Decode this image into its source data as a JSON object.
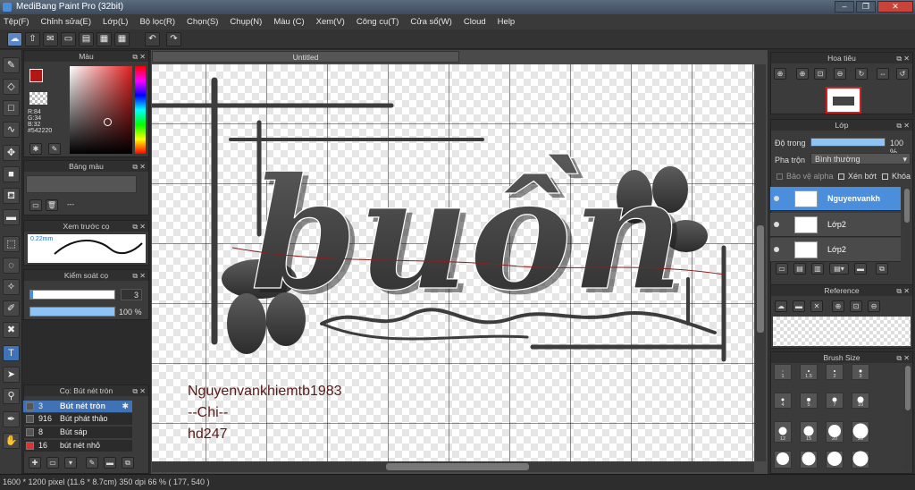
{
  "window": {
    "title": "MediBang Paint Pro (32bit)"
  },
  "menu": [
    "Tệp(F)",
    "Chỉnh sửa(E)",
    "Lớp(L)",
    "Bộ lọc(R)",
    "Chọn(S)",
    "Chụp(N)",
    "Màu (C)",
    "Xem(V)",
    "Công cụ(T)",
    "Cửa sổ(W)",
    "Cloud",
    "Help"
  ],
  "color_panel": {
    "title": "Màu",
    "r": "R:84",
    "g": "G:34",
    "b": "B:32",
    "hex": "#542220"
  },
  "palette_panel": {
    "title": "Bảng màu",
    "empty": "---"
  },
  "preview_panel": {
    "title": "Xem trước cọ",
    "size": "0.22mm"
  },
  "brush_control": {
    "title": "Kiểm soát cọ",
    "size_value": "3",
    "opacity_value": "100 %"
  },
  "brush_list": {
    "title": "Cọ: Bút nét tròn",
    "items": [
      {
        "size": "3",
        "name": "Bút nét tròn",
        "color": "#555555"
      },
      {
        "size": "916",
        "name": "Bút phát thảo",
        "color": "#555555"
      },
      {
        "size": "8",
        "name": "Bút sáp",
        "color": "#555555"
      },
      {
        "size": "16",
        "name": "bút nét nhỏ",
        "color": "#e03030"
      }
    ]
  },
  "document": {
    "tab": "Untitled"
  },
  "artwork": {
    "word": "buồn",
    "signature_lines": [
      "Nguyenvankhiemtb1983",
      "--Chi--",
      "hd247"
    ]
  },
  "navigator": {
    "title": "Hoa tiêu"
  },
  "layer_panel": {
    "title": "Lớp",
    "opacity_label": "Độ trong",
    "opacity_value": "100 %",
    "blend_label": "Pha trộn",
    "blend_value": "Bình thường",
    "protect_alpha": "Bảo vệ alpha",
    "clipping": "Xén bớt",
    "lock": "Khóa",
    "layers": [
      {
        "name": "Nguyenvankh",
        "selected": true
      },
      {
        "name": "Lớp2",
        "selected": false
      },
      {
        "name": "Lớp2",
        "selected": false
      }
    ]
  },
  "reference_panel": {
    "title": "Reference"
  },
  "brush_size_panel": {
    "title": "Brush Size",
    "sizes": [
      "1",
      "1.5",
      "2",
      "3",
      "4",
      "5",
      "7",
      "10",
      "12",
      "15",
      "20",
      "25"
    ]
  },
  "status": {
    "text": "1600 * 1200 pixel  (11.6 * 8.7cm)  350 dpi  66 %  ( 177, 540 )"
  },
  "colors": {
    "accent": "#4b8fdc",
    "fg_color": "#b01818",
    "drawing": "#4a4a4a",
    "sig_color": "#5a1a18"
  }
}
